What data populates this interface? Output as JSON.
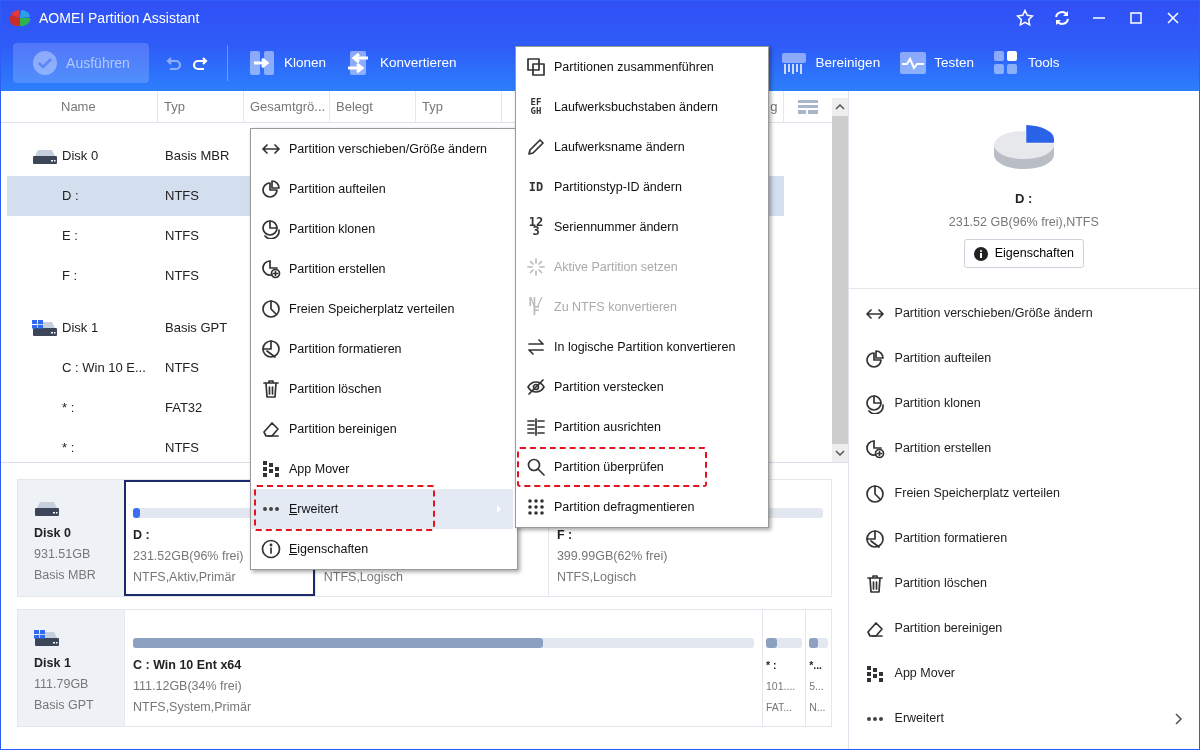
{
  "window": {
    "title": "AOMEI Partition Assistant"
  },
  "toolbar": {
    "apply": {
      "label": "Ausführen",
      "disabled": true
    },
    "undo": {
      "disabled": true
    },
    "redo": {
      "disabled": false
    },
    "items": [
      {
        "label": "Klonen"
      },
      {
        "label": "Konvertieren"
      },
      {
        "label": "Bereinigen"
      },
      {
        "label": "Testen"
      },
      {
        "label": "Tools"
      }
    ]
  },
  "table": {
    "columns": [
      "Name",
      "Typ",
      "Gesamtgrö...",
      "Belegt",
      "Typ",
      "g"
    ],
    "rows": [
      {
        "kind": "disk",
        "name": "Disk 0",
        "type": "Basis MBR",
        "system": false,
        "selected": false
      },
      {
        "kind": "partition",
        "name": "D :",
        "type": "NTFS",
        "selected": true
      },
      {
        "kind": "partition",
        "name": "E :",
        "type": "NTFS",
        "selected": false
      },
      {
        "kind": "partition",
        "name": "F :",
        "type": "NTFS",
        "selected": false
      },
      {
        "kind": "disk",
        "name": "Disk 1",
        "type": "Basis GPT",
        "system": true,
        "selected": false
      },
      {
        "kind": "partition",
        "name": "C : Win 10 E...",
        "type": "NTFS",
        "selected": false
      },
      {
        "kind": "partition",
        "name": "* :",
        "type": "FAT32",
        "selected": false
      },
      {
        "kind": "partition",
        "name": "* :",
        "type": "NTFS",
        "selected": false
      }
    ]
  },
  "disk_map": {
    "disks": [
      {
        "name": "Disk 0",
        "size": "931.51GB",
        "type": "Basis MBR",
        "system": false,
        "partitions": [
          {
            "name": "D :",
            "size": "231.52GB(96% frei)",
            "info": "NTFS,Aktiv,Primär",
            "level": 0.04,
            "selected": true
          },
          {
            "info": "NTFS,Logisch",
            "selected": false
          },
          {
            "name": "F :",
            "size": "399.99GB(62% frei)",
            "info": "NTFS,Logisch",
            "selected": false
          }
        ]
      },
      {
        "name": "Disk 1",
        "size": "111.79GB",
        "type": "Basis GPT",
        "system": true,
        "partitions": [
          {
            "name": "C : Win 10 Ent x64",
            "size": "111.12GB(34% frei)",
            "info": "NTFS,System,Primär",
            "level": 0.66,
            "selected": false
          },
          {
            "name": "* :",
            "size": "101....",
            "info": "FAT...",
            "level": 0.3,
            "selected": false
          },
          {
            "name": "*...",
            "size": "5...",
            "info": "N...",
            "level": 0.5,
            "selected": false
          }
        ]
      }
    ]
  },
  "details": {
    "name": "D :",
    "info": "231.52 GB(96% frei),NTFS",
    "button": "Eigenschaften",
    "actions": [
      {
        "label": "Partition verschieben/Größe ändern",
        "submenu": false
      },
      {
        "label": "Partition aufteilen",
        "submenu": false
      },
      {
        "label": "Partition klonen",
        "submenu": false
      },
      {
        "label": "Partition erstellen",
        "submenu": false
      },
      {
        "label": "Freien Speicherplatz verteilen",
        "submenu": false
      },
      {
        "label": "Partition formatieren",
        "submenu": false
      },
      {
        "label": "Partition löschen",
        "submenu": false
      },
      {
        "label": "Partition bereinigen",
        "submenu": false
      },
      {
        "label": "App Mover",
        "submenu": false
      },
      {
        "label": "Erweitert",
        "submenu": true
      }
    ]
  },
  "context_menu": {
    "items": [
      {
        "label": "Partition verschieben/Größe ändern",
        "selected": false,
        "submenu": false,
        "annotated": false,
        "mnemonic": false
      },
      {
        "label": "Partition aufteilen",
        "selected": false,
        "submenu": false,
        "annotated": false,
        "mnemonic": false
      },
      {
        "label": "Partition klonen",
        "selected": false,
        "submenu": false,
        "annotated": false,
        "mnemonic": false
      },
      {
        "label": "Partition erstellen",
        "selected": false,
        "submenu": false,
        "annotated": false,
        "mnemonic": false
      },
      {
        "label": "Freien Speicherplatz verteilen",
        "selected": false,
        "submenu": false,
        "annotated": false,
        "mnemonic": false
      },
      {
        "label": "Partition formatieren",
        "selected": false,
        "submenu": false,
        "annotated": false,
        "mnemonic": false
      },
      {
        "label": "Partition löschen",
        "selected": false,
        "submenu": false,
        "annotated": false,
        "mnemonic": false
      },
      {
        "label": "Partition bereinigen",
        "selected": false,
        "submenu": false,
        "annotated": false,
        "mnemonic": false
      },
      {
        "label": "App Mover",
        "selected": false,
        "submenu": false,
        "annotated": false,
        "mnemonic": false
      },
      {
        "label": "Erweitert",
        "selected": true,
        "submenu": true,
        "annotated": true,
        "mnemonic": true
      },
      {
        "label": "Eigenschaften",
        "selected": false,
        "submenu": false,
        "annotated": false,
        "mnemonic": true
      }
    ]
  },
  "submenu": {
    "items": [
      {
        "label": "Partitionen zusammenführen",
        "disabled": false,
        "selected": false,
        "annotated": false
      },
      {
        "label": "Laufwerksbuchstaben ändern",
        "icon_text": "EF GH",
        "disabled": false,
        "selected": false,
        "annotated": false
      },
      {
        "label": "Laufwerksname ändern",
        "disabled": false,
        "selected": false,
        "annotated": false
      },
      {
        "label": "Partitionstyp-ID ändern",
        "icon_text": "ID",
        "disabled": false,
        "selected": false,
        "annotated": false
      },
      {
        "label": "Seriennummer ändern",
        "icon_text": "123",
        "disabled": false,
        "selected": false,
        "annotated": false
      },
      {
        "label": "Aktive Partition setzen",
        "disabled": true,
        "selected": false,
        "annotated": false
      },
      {
        "label": "Zu NTFS konvertieren",
        "icon_text": "N/F",
        "disabled": true,
        "selected": false,
        "annotated": false
      },
      {
        "label": "In logische Partition konvertieren",
        "disabled": false,
        "selected": false,
        "annotated": false
      },
      {
        "label": "Partition verstecken",
        "disabled": false,
        "selected": false,
        "annotated": false
      },
      {
        "label": "Partition ausrichten",
        "disabled": false,
        "selected": false,
        "annotated": false
      },
      {
        "label": "Partition überprüfen",
        "disabled": false,
        "selected": false,
        "annotated": true
      },
      {
        "label": "Partition defragmentieren",
        "disabled": false,
        "selected": false,
        "annotated": false
      }
    ]
  }
}
